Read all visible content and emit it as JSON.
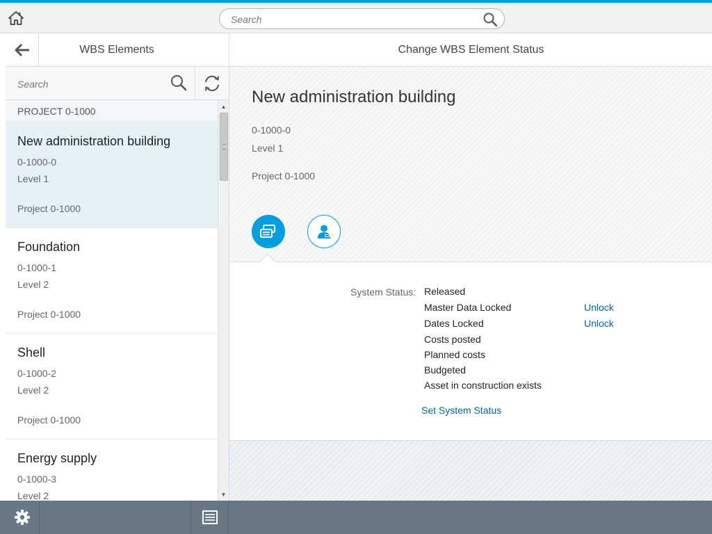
{
  "shell": {
    "search_placeholder": "Search",
    "accent_color": "#009de0"
  },
  "master": {
    "title": "WBS Elements",
    "search_placeholder": "Search",
    "group_header": "PROJECT 0-1000",
    "items": [
      {
        "title": "New administration building",
        "id": "0-1000-0",
        "level": "Level 1",
        "project": "Project 0-1000",
        "selected": true
      },
      {
        "title": "Foundation",
        "id": "0-1000-1",
        "level": "Level 2",
        "project": "Project 0-1000",
        "selected": false
      },
      {
        "title": "Shell",
        "id": "0-1000-2",
        "level": "Level 2",
        "project": "Project 0-1000",
        "selected": false
      },
      {
        "title": "Energy supply",
        "id": "0-1000-3",
        "level": "Level 2",
        "project": "",
        "selected": false
      }
    ]
  },
  "detail": {
    "title": "Change WBS Element Status",
    "object": {
      "title": "New administration building",
      "id": "0-1000-0",
      "level": "Level 1",
      "project": "Project 0-1000"
    },
    "tabs": [
      {
        "icon": "status-tab-icon",
        "active": true
      },
      {
        "icon": "user-tab-icon",
        "active": false
      }
    ],
    "system_status_label": "System Status:",
    "statuses": [
      {
        "text": "Released",
        "action": ""
      },
      {
        "text": "Master Data Locked",
        "action": "Unlock"
      },
      {
        "text": "Dates Locked",
        "action": "Unlock"
      },
      {
        "text": "Costs posted",
        "action": ""
      },
      {
        "text": "Planned costs",
        "action": ""
      },
      {
        "text": "Budgeted",
        "action": ""
      },
      {
        "text": "Asset in construction exists",
        "action": ""
      }
    ],
    "set_status_link": "Set System Status"
  },
  "footer": {
    "settings_icon": "gear-icon",
    "list_icon": "list-icon",
    "background": "#687883"
  }
}
